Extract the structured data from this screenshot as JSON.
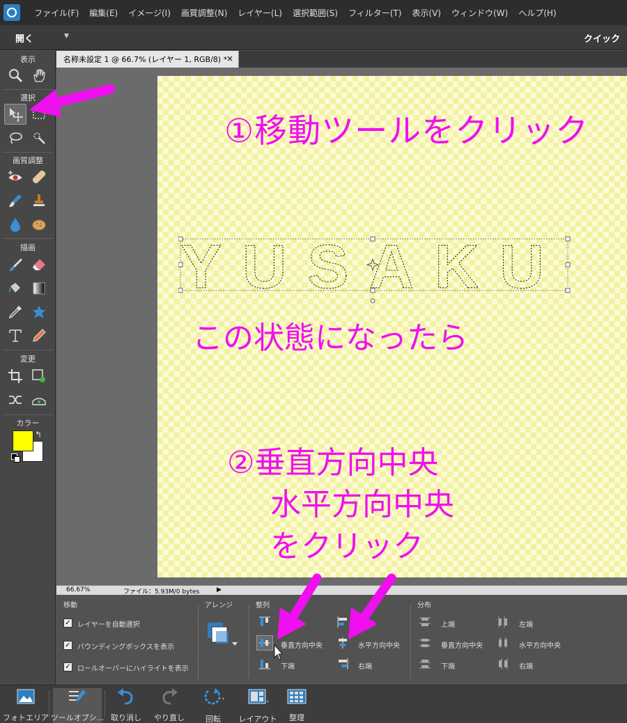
{
  "menubar": {
    "items": [
      "ファイル(F)",
      "編集(E)",
      "イメージ(I)",
      "画質調整(N)",
      "レイヤー(L)",
      "選択範囲(S)",
      "フィルター(T)",
      "表示(V)",
      "ウィンドウ(W)",
      "ヘルプ(H)"
    ]
  },
  "openbar": {
    "open_label": "開く",
    "mode_label": "クイック"
  },
  "toolbar": {
    "sections": {
      "view": "表示",
      "select": "選択",
      "enhance": "画質調整",
      "draw": "描画",
      "modify": "変更",
      "color": "カラー"
    },
    "foreground_color": "#ffff00",
    "background_color": "#ffffff"
  },
  "document": {
    "tab_title": "名称未設定 1 @ 66.7% (レイヤー 1, RGB/8) *",
    "close_glyph": "×",
    "text_content": "YUSAKU"
  },
  "annotations": {
    "step1": "①移動ツールをクリック",
    "status": "この状態になったら",
    "step2_line1": "②垂直方向中央",
    "step2_line2": "水平方向中央",
    "step2_line3": "をクリック",
    "color": "#f00ff0"
  },
  "statusbar": {
    "zoom": "66.67%",
    "file": "ファイル：5.93M/0 bytes",
    "arrow": "▶"
  },
  "options": {
    "move_title": "移動",
    "checks": [
      {
        "label": "レイヤーを自動選択",
        "checked": true
      },
      {
        "label": "バウンディングボックスを表示",
        "checked": true
      },
      {
        "label": "ロールオーバーにハイライトを表示",
        "checked": true
      }
    ],
    "arrange_title": "アレンジ",
    "align_title": "整列",
    "align_items": {
      "top": "上端",
      "vertical_center": "垂直方向中央",
      "bottom": "下端",
      "left": "左端",
      "horizontal_center": "水平方向中央",
      "right": "右端"
    },
    "distribute_title": "分布",
    "distribute_items": {
      "top": "上端",
      "vertical_center": "垂直方向中央",
      "bottom": "下端",
      "left": "左端",
      "horizontal_center": "水平方向中央",
      "right": "右端"
    }
  },
  "taskbar": {
    "photo_bin": "フォトエリア",
    "tool_options": "ツールオプシ...",
    "undo": "取り消し",
    "redo": "やり直し",
    "rotate": "回転",
    "layout": "レイアウト",
    "organize": "整理"
  }
}
